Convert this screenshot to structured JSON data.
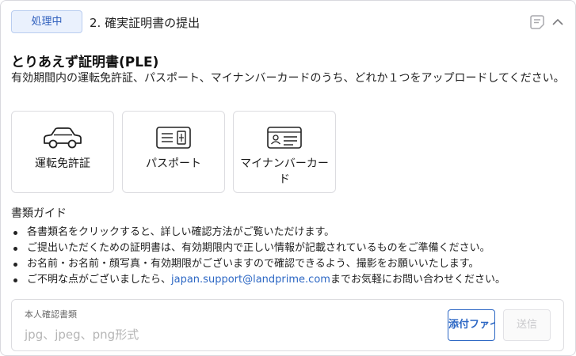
{
  "header": {
    "status_badge": "処理中",
    "step_title": "2. 確実証明書の提出",
    "icons": [
      "memo-icon",
      "chevron-up-icon"
    ]
  },
  "section": {
    "title": "とりあえず証明書(PLE)",
    "description": "有効期間内の運転免許証、パスポート、マイナンバーカードのうち、どれか１つをアップロードしてください。"
  },
  "documents": [
    {
      "label": "運転免許証",
      "icon": "car-icon"
    },
    {
      "label": "パスポート",
      "icon": "passport-icon"
    },
    {
      "label": "マイナンバーカード",
      "icon": "id-card-icon"
    }
  ],
  "guide": {
    "title": "書類ガイド",
    "items": [
      "各書類名をクリックすると、詳しい確認方法がご覧いただけます。",
      "ご提出いただくための証明書は、有効期限内で正しい情報が記載されているものをご準備ください。",
      "お名前・お名前・顔写真・有効期限がございますので確認できるよう、撮影をお願いいたします。"
    ],
    "contact": {
      "prefix": "ご不明な点がございましたら、",
      "email": "japan.support@landprime.com",
      "suffix": "までお気軽にお問い合わせください。"
    }
  },
  "upload": {
    "label": "本人確認書類",
    "placeholder": "jpg、jpeg、png形式",
    "attach_label": "添付ファイル",
    "send_label": "送信"
  },
  "colors": {
    "accent": "#2c67c4",
    "badge_bg": "#eaf1fd",
    "border": "#dcdce0"
  }
}
